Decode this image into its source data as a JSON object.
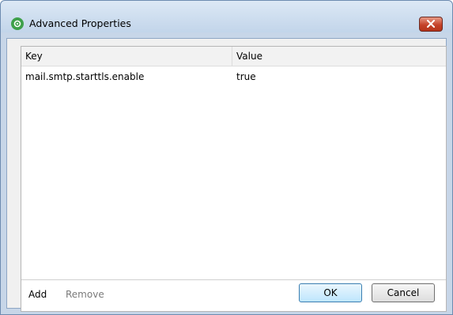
{
  "window": {
    "title": "Advanced Properties",
    "close_label": "×"
  },
  "icons": {
    "app": "app-icon",
    "close": "close-icon"
  },
  "table": {
    "columns": [
      "Key",
      "Value"
    ],
    "rows": [
      {
        "key": "mail.smtp.starttls.enable",
        "value": "true"
      }
    ]
  },
  "actions": {
    "add_label": "Add",
    "remove_label": "Remove"
  },
  "buttons": {
    "ok_label": "OK",
    "cancel_label": "Cancel"
  },
  "colors": {
    "accent": "#3ea04a",
    "close": "#c5432a"
  }
}
